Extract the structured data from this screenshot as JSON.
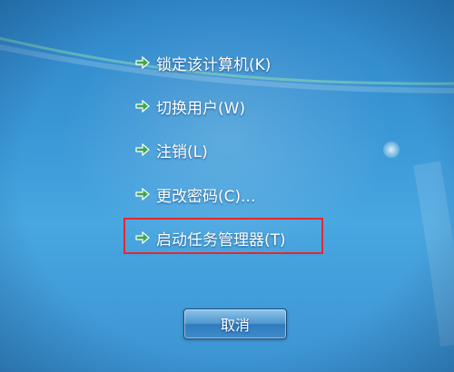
{
  "menu": {
    "items": [
      {
        "label": "锁定该计算机(K)",
        "icon": "green-arrow-icon"
      },
      {
        "label": "切换用户(W)",
        "icon": "green-arrow-icon"
      },
      {
        "label": "注销(L)",
        "icon": "green-arrow-icon"
      },
      {
        "label": "更改密码(C)...",
        "icon": "green-arrow-icon"
      },
      {
        "label": "启动任务管理器(T)",
        "icon": "green-arrow-icon",
        "highlighted": true
      }
    ]
  },
  "cancel_button": {
    "label": "取消"
  },
  "colors": {
    "background": "#3a97d6",
    "arrow": "#3fa84a",
    "highlight_border": "#e8262c"
  }
}
